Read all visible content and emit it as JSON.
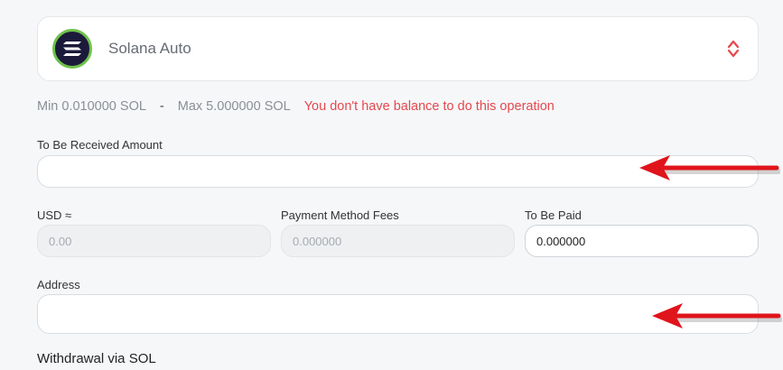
{
  "coin": {
    "name": "Solana Auto",
    "icon": "solana-logo-icon",
    "accent": "#6fc24a"
  },
  "limits": {
    "min": "Min 0.010000 SOL",
    "separator": "-",
    "max": "Max 5.000000 SOL",
    "warning": "You don't have balance to do this operation",
    "warning_color": "#e5484d"
  },
  "received": {
    "label": "To Be Received Amount",
    "value": ""
  },
  "usd": {
    "label": "USD ≈",
    "value": "0.00"
  },
  "fees": {
    "label": "Payment Method Fees",
    "value": "0.000000"
  },
  "paid": {
    "label": "To Be Paid",
    "value": "0.000000"
  },
  "address": {
    "label": "Address",
    "value": ""
  },
  "section": {
    "title": "Withdrawal via SOL"
  },
  "annotations": {
    "arrow_color": "#e0141b"
  }
}
